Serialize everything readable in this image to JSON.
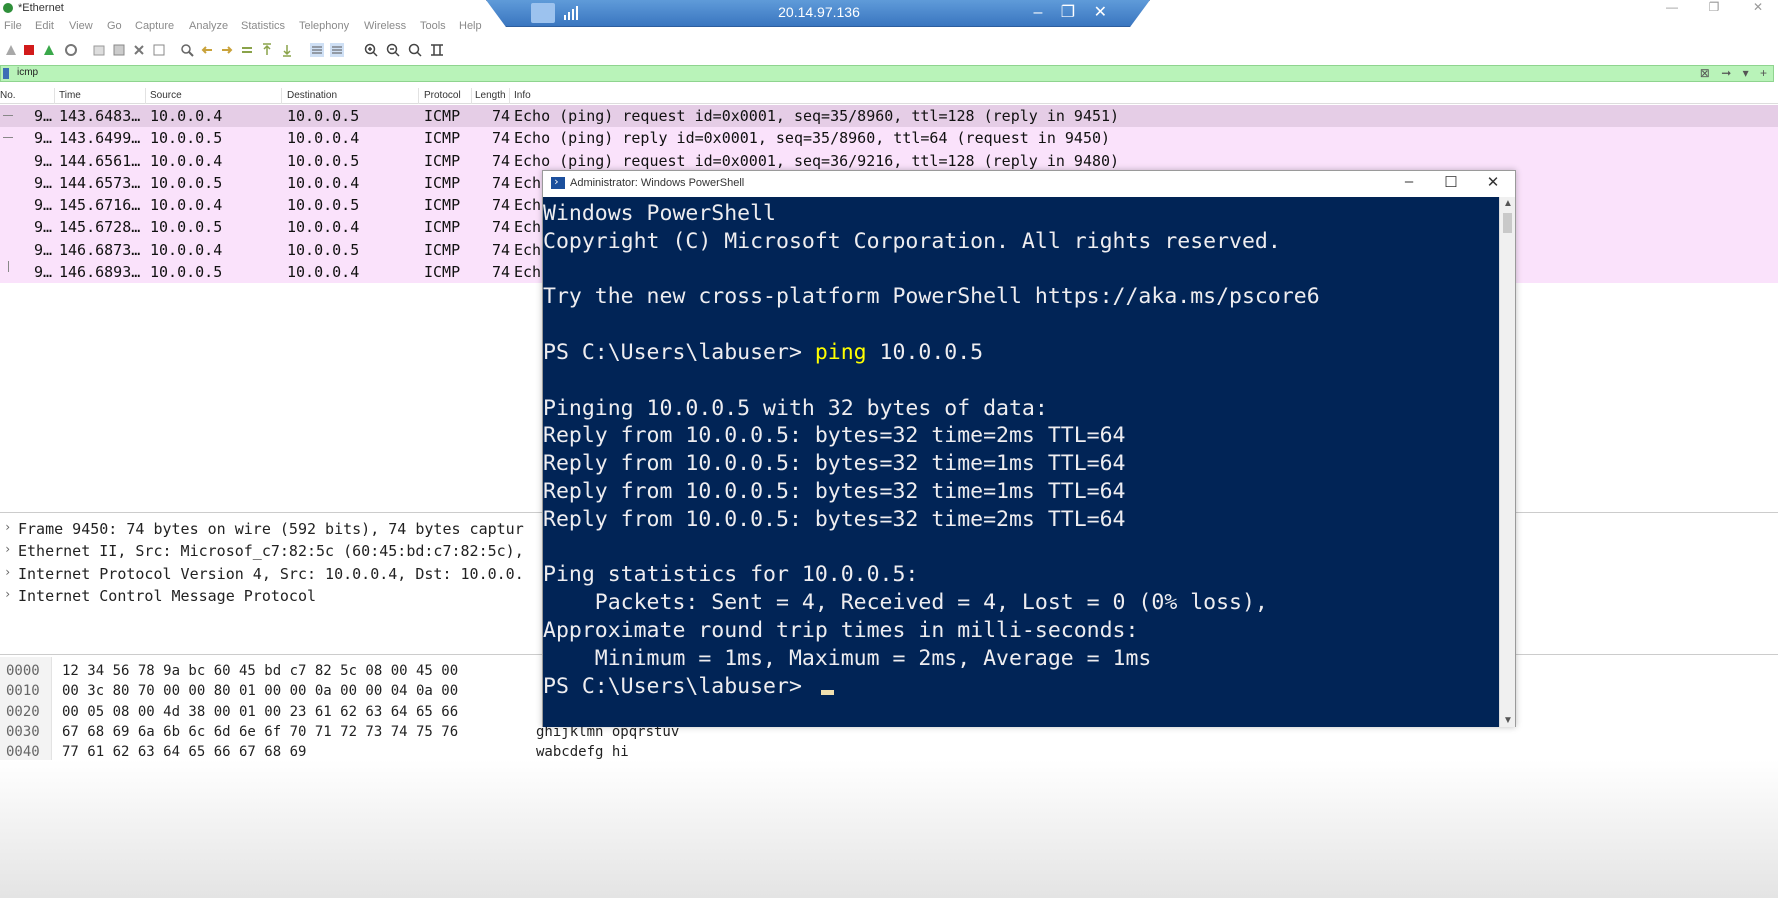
{
  "wireshark": {
    "title": "*Ethernet",
    "menu": [
      "File",
      "Edit",
      "View",
      "Go",
      "Capture",
      "Analyze",
      "Statistics",
      "Telephony",
      "Wireless",
      "Tools",
      "Help"
    ],
    "filter": {
      "value": "icmp"
    },
    "columns": [
      "No.",
      "Time",
      "Source",
      "Destination",
      "Protocol",
      "Length",
      "Info"
    ],
    "packets": [
      {
        "no": "9…",
        "time": "143.6483…",
        "src": "10.0.0.4",
        "dst": "10.0.0.5",
        "proto": "ICMP",
        "len": "74",
        "info": "Echo (ping) request  id=0x0001, seq=35/8960, ttl=128 (reply in 9451)"
      },
      {
        "no": "9…",
        "time": "143.6499…",
        "src": "10.0.0.5",
        "dst": "10.0.0.4",
        "proto": "ICMP",
        "len": "74",
        "info": "Echo (ping) reply    id=0x0001, seq=35/8960, ttl=64 (request in 9450)"
      },
      {
        "no": "9…",
        "time": "144.6561…",
        "src": "10.0.0.4",
        "dst": "10.0.0.5",
        "proto": "ICMP",
        "len": "74",
        "info": "Echo (ping) request  id=0x0001, seq=36/9216, ttl=128 (reply in 9480)"
      },
      {
        "no": "9…",
        "time": "144.6573…",
        "src": "10.0.0.5",
        "dst": "10.0.0.4",
        "proto": "ICMP",
        "len": "74",
        "info": "Ech"
      },
      {
        "no": "9…",
        "time": "145.6716…",
        "src": "10.0.0.4",
        "dst": "10.0.0.5",
        "proto": "ICMP",
        "len": "74",
        "info": "Ech"
      },
      {
        "no": "9…",
        "time": "145.6728…",
        "src": "10.0.0.5",
        "dst": "10.0.0.4",
        "proto": "ICMP",
        "len": "74",
        "info": "Ech"
      },
      {
        "no": "9…",
        "time": "146.6873…",
        "src": "10.0.0.4",
        "dst": "10.0.0.5",
        "proto": "ICMP",
        "len": "74",
        "info": "Ech"
      },
      {
        "no": "9…",
        "time": "146.6893…",
        "src": "10.0.0.5",
        "dst": "10.0.0.4",
        "proto": "ICMP",
        "len": "74",
        "info": "Ech"
      }
    ],
    "details": [
      "Frame 9450: 74 bytes on wire (592 bits), 74 bytes captur",
      "Ethernet II, Src: Microsof_c7:82:5c (60:45:bd:c7:82:5c),",
      "Internet Protocol Version 4, Src: 10.0.0.4, Dst: 10.0.0.",
      "Internet Control Message Protocol"
    ],
    "bytes": [
      {
        "off": "0000",
        "hex": "12 34 56 78 9a bc 60 45  bd c7 82 5c 08 00 45 00",
        "ascii": ""
      },
      {
        "off": "0010",
        "hex": "00 3c 80 70 00 00 80 01  00 00 0a 00 00 04 0a 00",
        "ascii": ""
      },
      {
        "off": "0020",
        "hex": "00 05 08 00 4d 38 00 01  00 23 61 62 63 64 65 66",
        "ascii": ""
      },
      {
        "off": "0030",
        "hex": "67 68 69 6a 6b 6c 6d 6e  6f 70 71 72 73 74 75 76",
        "ascii": "ghijklmn opqrstuv"
      },
      {
        "off": "0040",
        "hex": "77 61 62 63 64 65 66 67  68 69",
        "ascii": "wabcdefg hi"
      }
    ],
    "colors": {
      "row": "#fae2fb",
      "selected_row": "#e5cde6",
      "filter_bg": "#b9f3b9"
    }
  },
  "remote_bar": {
    "ip": "20.14.97.136"
  },
  "powershell": {
    "title": "Administrator: Windows PowerShell",
    "lines": [
      "Windows PowerShell",
      "Copyright (C) Microsoft Corporation. All rights reserved.",
      "",
      "Try the new cross-platform PowerShell https://aka.ms/pscore6",
      "",
      "PS C:\\Users\\labuser> ",
      "",
      "Pinging 10.0.0.5 with 32 bytes of data:",
      "Reply from 10.0.0.5: bytes=32 time=2ms TTL=64",
      "Reply from 10.0.0.5: bytes=32 time=1ms TTL=64",
      "Reply from 10.0.0.5: bytes=32 time=1ms TTL=64",
      "Reply from 10.0.0.5: bytes=32 time=2ms TTL=64",
      "",
      "Ping statistics for 10.0.0.5:",
      "    Packets: Sent = 4, Received = 4, Lost = 0 (0% loss),",
      "Approximate round trip times in milli-seconds:",
      "    Minimum = 1ms, Maximum = 2ms, Average = 1ms",
      "PS C:\\Users\\labuser> "
    ],
    "command": "ping",
    "command_args": " 10.0.0.5",
    "colors": {
      "background": "#012456",
      "text": "#eeedf0",
      "command": "#ffff00"
    }
  }
}
